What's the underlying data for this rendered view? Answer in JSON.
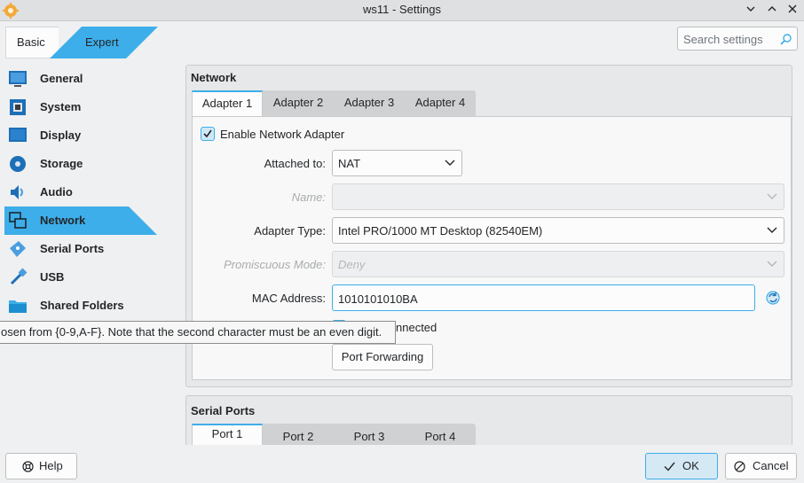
{
  "window": {
    "title": "ws11 - Settings"
  },
  "mode": {
    "basic": "Basic",
    "expert": "Expert",
    "active": "Expert"
  },
  "search": {
    "placeholder": "Search settings"
  },
  "sidebar": {
    "items": [
      {
        "label": "General",
        "icon": "general-icon"
      },
      {
        "label": "System",
        "icon": "system-icon"
      },
      {
        "label": "Display",
        "icon": "display-icon"
      },
      {
        "label": "Storage",
        "icon": "storage-icon"
      },
      {
        "label": "Audio",
        "icon": "audio-icon"
      },
      {
        "label": "Network",
        "icon": "network-icon"
      },
      {
        "label": "Serial Ports",
        "icon": "serial-ports-icon"
      },
      {
        "label": "USB",
        "icon": "usb-icon"
      },
      {
        "label": "Shared Folders",
        "icon": "shared-folders-icon"
      }
    ],
    "selected": "Network"
  },
  "tooltip": "osen from {0-9,A-F}. Note that the second character must be an even digit.",
  "network": {
    "title": "Network",
    "tabs": [
      "Adapter 1",
      "Adapter 2",
      "Adapter 3",
      "Adapter 4"
    ],
    "active_tab": "Adapter 1",
    "enable_label": "Enable Network Adapter",
    "enable_checked": true,
    "attached_label": "Attached to:",
    "attached_value": "NAT",
    "name_label": "Name:",
    "name_value": "",
    "adapter_type_label": "Adapter Type:",
    "adapter_type_value": "Intel PRO/1000 MT Desktop (82540EM)",
    "promiscuous_label": "Promiscuous Mode:",
    "promiscuous_value": "Deny",
    "mac_label": "MAC Address:",
    "mac_value": "1010101010BA",
    "cable_partial": "nnected",
    "port_forwarding": "Port Forwarding"
  },
  "serial": {
    "title": "Serial Ports",
    "tabs": [
      "Port 1",
      "Port 2",
      "Port 3",
      "Port 4"
    ],
    "active_tab": "Port 1"
  },
  "footer": {
    "help": "Help",
    "ok": "OK",
    "cancel": "Cancel"
  },
  "colors": {
    "accent": "#3daee9",
    "selection": "#3daee9"
  }
}
